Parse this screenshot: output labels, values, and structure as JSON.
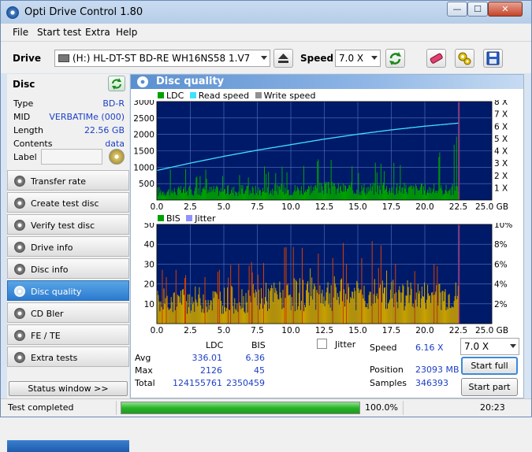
{
  "app": {
    "title": "Opti Drive Control 1.80"
  },
  "window_buttons": {
    "minimize": "—",
    "maximize": "☐",
    "close": "✕"
  },
  "menu": [
    "File",
    "Start test",
    "Extra",
    "Help"
  ],
  "toolbar": {
    "drive_label": "Drive",
    "drive_value": "(H:)  HL-DT-ST BD-RE  WH16NS58 1.V7",
    "speed_label": "Speed",
    "speed_value": "7.0 X"
  },
  "disc": {
    "header": "Disc",
    "rows": [
      {
        "label": "Type",
        "value": "BD-R"
      },
      {
        "label": "MID",
        "value": "VERBATIMe (000)"
      },
      {
        "label": "Length",
        "value": "22.56 GB"
      },
      {
        "label": "Contents",
        "value": "data"
      }
    ],
    "label_field": "Label"
  },
  "nav": [
    {
      "label": "Transfer rate",
      "icon": "disc-icon",
      "active": false
    },
    {
      "label": "Create test disc",
      "icon": "disc-icon",
      "active": false
    },
    {
      "label": "Verify test disc",
      "icon": "disc-icon",
      "active": false
    },
    {
      "label": "Drive info",
      "icon": "disc-icon",
      "active": false
    },
    {
      "label": "Disc info",
      "icon": "disc-icon",
      "active": false
    },
    {
      "label": "Disc quality",
      "icon": "disc-icon",
      "active": true
    },
    {
      "label": "CD Bler",
      "icon": "disc-icon",
      "active": false
    },
    {
      "label": "FE / TE",
      "icon": "disc-icon",
      "active": false
    },
    {
      "label": "Extra tests",
      "icon": "disc-icon",
      "active": false
    }
  ],
  "status_window_button": "Status window >>",
  "panel": {
    "title": "Disc quality"
  },
  "chart_data": [
    {
      "type": "bar",
      "legend": [
        "LDC",
        "Read speed",
        "Write speed"
      ],
      "colors": {
        "LDC": "#00a000",
        "Read speed": "#40e0ff",
        "Write speed": "#909090",
        "background": "#001a6a",
        "grid": "#5577bb"
      },
      "x_ticks": [
        "0.0",
        "2.5",
        "5.0",
        "7.5",
        "10.0",
        "12.5",
        "15.0",
        "17.5",
        "20.0",
        "22.5",
        "25.0 GB"
      ],
      "y_ticks_left": [
        "500",
        "1000",
        "1500",
        "2000",
        "2500",
        "3000"
      ],
      "y_ticks_right": [
        "1 X",
        "2 X",
        "3 X",
        "4 X",
        "5 X",
        "6 X",
        "7 X",
        "8 X"
      ],
      "xlim": [
        0,
        25
      ],
      "ylim": [
        0,
        3000
      ],
      "y2lim": [
        0,
        8
      ],
      "data_end_gb": 22.56,
      "ldc_profile": {
        "x": [
          0,
          2.5,
          5,
          7.5,
          10,
          12.5,
          15,
          17.5,
          20,
          22.5
        ],
        "typical": [
          310,
          330,
          340,
          345,
          380,
          420,
          400,
          410,
          380,
          360
        ],
        "peak": [
          900,
          980,
          1000,
          1050,
          1300,
          1700,
          1300,
          1250,
          1150,
          2126
        ]
      },
      "read_speed": {
        "x": [
          0,
          2.5,
          5,
          7.5,
          10,
          12.5,
          15,
          17.5,
          20,
          22.5
        ],
        "y": [
          2.4,
          3.0,
          3.55,
          4.05,
          4.5,
          4.95,
          5.35,
          5.7,
          6.0,
          6.25
        ]
      }
    },
    {
      "type": "bar",
      "legend": [
        "BIS",
        "Jitter"
      ],
      "colors": {
        "BIS": "#c8a000",
        "BIS_high": "#d04000",
        "Jitter": "#9090ff",
        "background": "#001a6a",
        "grid": "#5577bb"
      },
      "x_ticks": [
        "0.0",
        "2.5",
        "5.0",
        "7.5",
        "10.0",
        "12.5",
        "15.0",
        "17.5",
        "20.0",
        "22.5",
        "25.0 GB"
      ],
      "y_ticks_left": [
        "10",
        "20",
        "30",
        "40",
        "50"
      ],
      "y_ticks_right": [
        "2%",
        "4%",
        "6%",
        "8%",
        "10%"
      ],
      "xlim": [
        0,
        25
      ],
      "ylim": [
        0,
        50
      ],
      "data_end_gb": 22.56,
      "bis_profile": {
        "x": [
          0,
          2.5,
          5,
          7.5,
          10,
          12.5,
          15,
          17.5,
          20,
          22.5
        ],
        "typical": [
          13,
          14,
          14,
          15,
          17,
          18,
          17,
          17,
          16,
          16
        ],
        "peak": [
          30,
          32,
          33,
          34,
          40,
          38,
          45,
          38,
          36,
          35
        ]
      }
    }
  ],
  "stats": {
    "col_ldc": "LDC",
    "col_bis": "BIS",
    "rows": [
      {
        "label": "Avg",
        "ldc": "336.01",
        "bis": "6.36"
      },
      {
        "label": "Max",
        "ldc": "2126",
        "bis": "45"
      },
      {
        "label": "Total",
        "ldc": "124155761",
        "bis": "2350459"
      }
    ],
    "jitter_label": "Jitter",
    "speed_label": "Speed",
    "speed_value": "6.16 X",
    "position_label": "Position",
    "position_value": "23093 MB",
    "samples_label": "Samples",
    "samples_value": "346393",
    "speed_select": "7.0 X",
    "start_full": "Start full",
    "start_part": "Start part"
  },
  "statusbar": {
    "text": "Test completed",
    "progress": 100.0,
    "progress_text": "100.0%",
    "time": "20:23"
  }
}
